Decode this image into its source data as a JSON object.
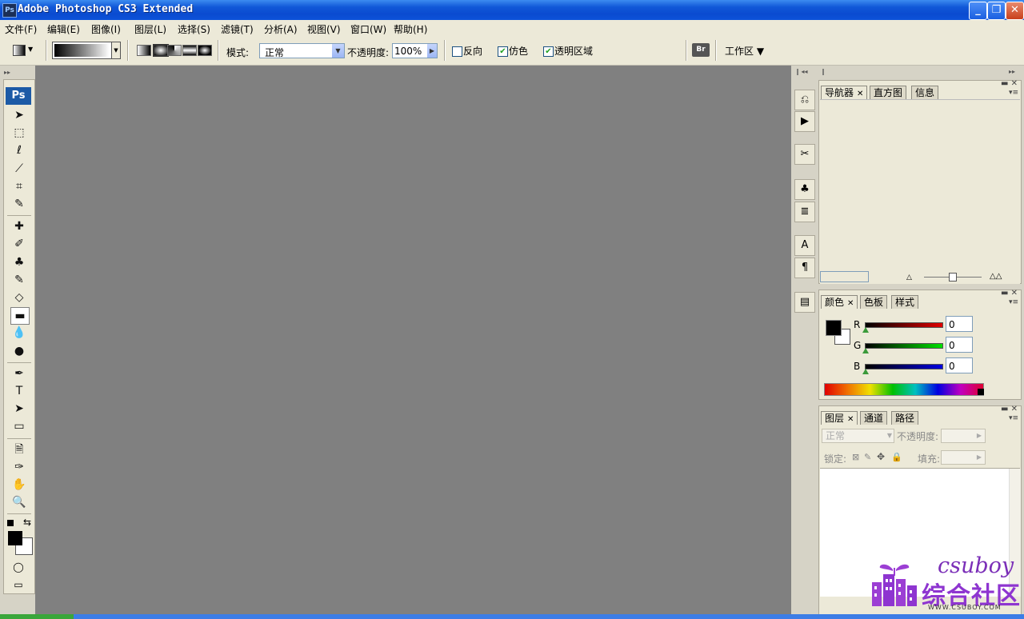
{
  "window": {
    "icon_text": "Ps",
    "title": "Adobe Photoshop CS3 Extended",
    "minimize": "_",
    "restore": "❐",
    "close": "✕"
  },
  "menu": [
    {
      "label": "文件(F)"
    },
    {
      "label": "编辑(E)"
    },
    {
      "label": "图像(I)"
    },
    {
      "label": "图层(L)"
    },
    {
      "label": "选择(S)"
    },
    {
      "label": "滤镜(T)"
    },
    {
      "label": "分析(A)"
    },
    {
      "label": "视图(V)"
    },
    {
      "label": "窗口(W)"
    },
    {
      "label": "帮助(H)"
    }
  ],
  "options": {
    "mode_label": "模式:",
    "mode_value": "正常",
    "opacity_label": "不透明度:",
    "opacity_value": "100%",
    "reverse_label": "反向",
    "reverse_checked": false,
    "dither_label": "仿色",
    "dither_checked": true,
    "transparency_label": "透明区域",
    "transparency_checked": true,
    "workspace_label": "工作区 ▼",
    "bridge_icon": "Br"
  },
  "toolbox": {
    "logo": "Ps",
    "tools": [
      {
        "name": "move-tool-icon",
        "glyph": "➤"
      },
      {
        "name": "marquee-tool-icon",
        "glyph": "⬚"
      },
      {
        "name": "lasso-tool-icon",
        "glyph": "ℓ"
      },
      {
        "name": "magic-wand-tool-icon",
        "glyph": "⟋"
      },
      {
        "name": "crop-tool-icon",
        "glyph": "⌗"
      },
      {
        "name": "slice-tool-icon",
        "glyph": "✎"
      },
      {
        "name": "healing-brush-tool-icon",
        "glyph": "✚"
      },
      {
        "name": "brush-tool-icon",
        "glyph": "✐"
      },
      {
        "name": "clone-stamp-tool-icon",
        "glyph": "♣"
      },
      {
        "name": "history-brush-tool-icon",
        "glyph": "✎"
      },
      {
        "name": "eraser-tool-icon",
        "glyph": "◇"
      },
      {
        "name": "gradient-tool-icon",
        "glyph": "▬"
      },
      {
        "name": "blur-tool-icon",
        "glyph": "💧"
      },
      {
        "name": "dodge-tool-icon",
        "glyph": "●"
      },
      {
        "name": "pen-tool-icon",
        "glyph": "✒"
      },
      {
        "name": "type-tool-icon",
        "glyph": "T"
      },
      {
        "name": "path-selection-tool-icon",
        "glyph": "➤"
      },
      {
        "name": "shape-tool-icon",
        "glyph": "▭"
      },
      {
        "name": "notes-tool-icon",
        "glyph": "🗎"
      },
      {
        "name": "eyedropper-tool-icon",
        "glyph": "✑"
      },
      {
        "name": "hand-tool-icon",
        "glyph": "✋"
      },
      {
        "name": "zoom-tool-icon",
        "glyph": "🔍"
      }
    ]
  },
  "panels": {
    "navigator": {
      "tabs": [
        "导航器",
        "直方图",
        "信息"
      ]
    },
    "color": {
      "tabs": [
        "颜色",
        "色板",
        "样式"
      ],
      "channels": [
        {
          "label": "R",
          "value": "0",
          "color": "#c00000"
        },
        {
          "label": "G",
          "value": "0",
          "color": "#00b000"
        },
        {
          "label": "B",
          "value": "0",
          "color": "#0000c0"
        }
      ]
    },
    "layers": {
      "tabs": [
        "图层",
        "通道",
        "路径"
      ],
      "blend_value": "正常",
      "opacity_label": "不透明度:",
      "lock_label": "锁定:",
      "fill_label": "填充:"
    }
  },
  "dock": [
    "history-icon",
    "actions-icon",
    "tool-presets-icon",
    "clone-source-icon",
    "layer-comps-icon",
    "character-icon",
    "paragraph-icon",
    "notes-panel-icon"
  ],
  "dock_glyphs": [
    "⎌",
    "▶",
    "✂",
    "♣",
    "≣",
    "A",
    "¶",
    "▤"
  ],
  "watermark": {
    "en": "csuboy",
    "cn": "综合社区",
    "url": "WWW.CSUBOY.COM"
  }
}
